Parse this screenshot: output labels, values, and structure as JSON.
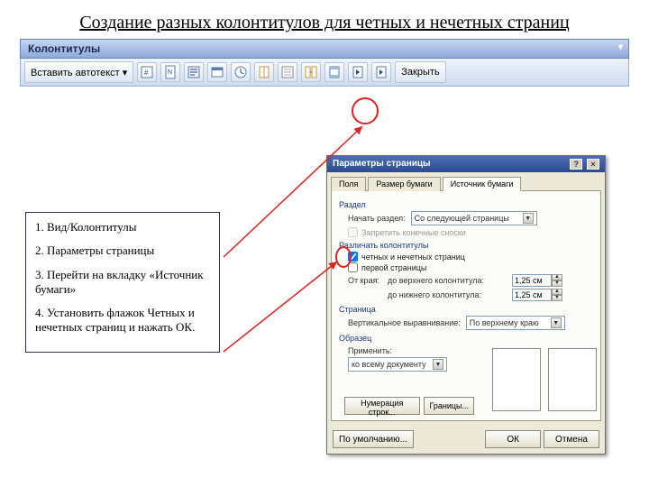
{
  "title": "Создание разных колонтитулов для четных и нечетных страниц",
  "toolbar": {
    "palette_title": "Колонтитулы",
    "autotext_label": "Вставить автотекст ▾",
    "close_label": "Закрыть"
  },
  "instructions": {
    "step1": "1. Вид/Колонтитулы",
    "step2": "2. Параметры страницы",
    "step3": "3. Перейти на вкладку «Источник бумаги»",
    "step4": "4. Установить флажок Четных и нечетных страниц и нажать ОК."
  },
  "dialog": {
    "title": "Параметры страницы",
    "tabs": {
      "t1": "Поля",
      "t2": "Размер бумаги",
      "t3": "Источник бумаги"
    },
    "section": {
      "label": "Раздел",
      "start_label": "Начать раздел:",
      "start_value": "Со следующей страницы",
      "suppress_checkbox": "Запретить конечные сноски"
    },
    "headers": {
      "label": "Различать колонтитулы",
      "odd_even": "четных и нечетных страниц",
      "first_page": "первой страницы",
      "from_edge": "От края:",
      "to_top": "до верхнего колонтитула:",
      "to_bottom": "до нижнего колонтитула:",
      "top_val": "1,25 см",
      "bot_val": "1,25 см"
    },
    "page": {
      "label": "Страница",
      "valign_label": "Вертикальное выравнивание:",
      "valign_value": "По верхнему краю"
    },
    "preview": {
      "label": "Образец",
      "apply_label": "Применить:",
      "apply_value": "ко всему документу"
    },
    "buttons": {
      "line_numbers": "Нумерация строк...",
      "borders": "Границы...",
      "default": "По умолчанию...",
      "ok": "ОК",
      "cancel": "Отмена"
    }
  }
}
